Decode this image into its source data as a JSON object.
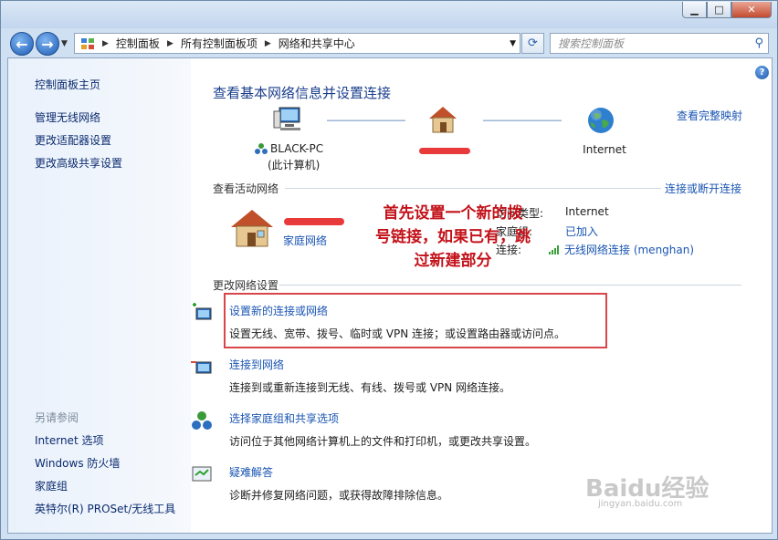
{
  "window": {
    "buttons": {
      "minimize": "▁",
      "maximize": "□",
      "close": "✕"
    }
  },
  "navbar": {
    "back": "←",
    "forward": "→",
    "breadcrumb": [
      "控制面板",
      "所有控制面板项",
      "网络和共享中心"
    ],
    "search_placeholder": "搜索控制面板"
  },
  "sidebar": {
    "home": "控制面板主页",
    "links": [
      "管理无线网络",
      "更改适配器设置",
      "更改高级共享设置"
    ],
    "see_also_title": "另请参阅",
    "see_also": [
      "Internet 选项",
      "Windows 防火墙",
      "家庭组",
      "英特尔(R) PROSet/无线工具"
    ]
  },
  "main": {
    "heading": "查看基本网络信息并设置连接",
    "full_map_link": "查看完整映射",
    "map": {
      "computer_name": "BLACK-PC",
      "computer_sub": "(此计算机)",
      "internet": "Internet"
    },
    "active_label": "查看活动网络",
    "connect_link": "连接或断开连接",
    "active_network": {
      "type_link": "家庭网络",
      "access_type_label": "访问类型:",
      "access_type_value": "Internet",
      "homegroup_label": "家庭组:",
      "homegroup_value": "已加入",
      "connection_label": "连接:",
      "connection_value": "无线网络连接 (menghan)"
    },
    "change_label": "更改网络设置",
    "tasks": [
      {
        "title": "设置新的连接或网络",
        "desc": "设置无线、宽带、拨号、临时或 VPN 连接；或设置路由器或访问点。"
      },
      {
        "title": "连接到网络",
        "desc": "连接到或重新连接到无线、有线、拨号或 VPN 网络连接。"
      },
      {
        "title": "选择家庭组和共享选项",
        "desc": "访问位于其他网络计算机上的文件和打印机，或更改共享设置。"
      },
      {
        "title": "疑难解答",
        "desc": "诊断并修复网络问题，或获得故障排除信息。"
      }
    ]
  },
  "annotation": {
    "lines": [
      "首先设置一个新的拨",
      "号链接，如果已有，跳",
      "过新建部分"
    ]
  },
  "watermark": {
    "text": "Baidu经验",
    "sub": "jingyan.baidu.com"
  },
  "colors": {
    "link": "#1a55b3",
    "heading": "#1a3e8c",
    "annotation": "#c3121a",
    "highlight_box": "#d8464a"
  }
}
